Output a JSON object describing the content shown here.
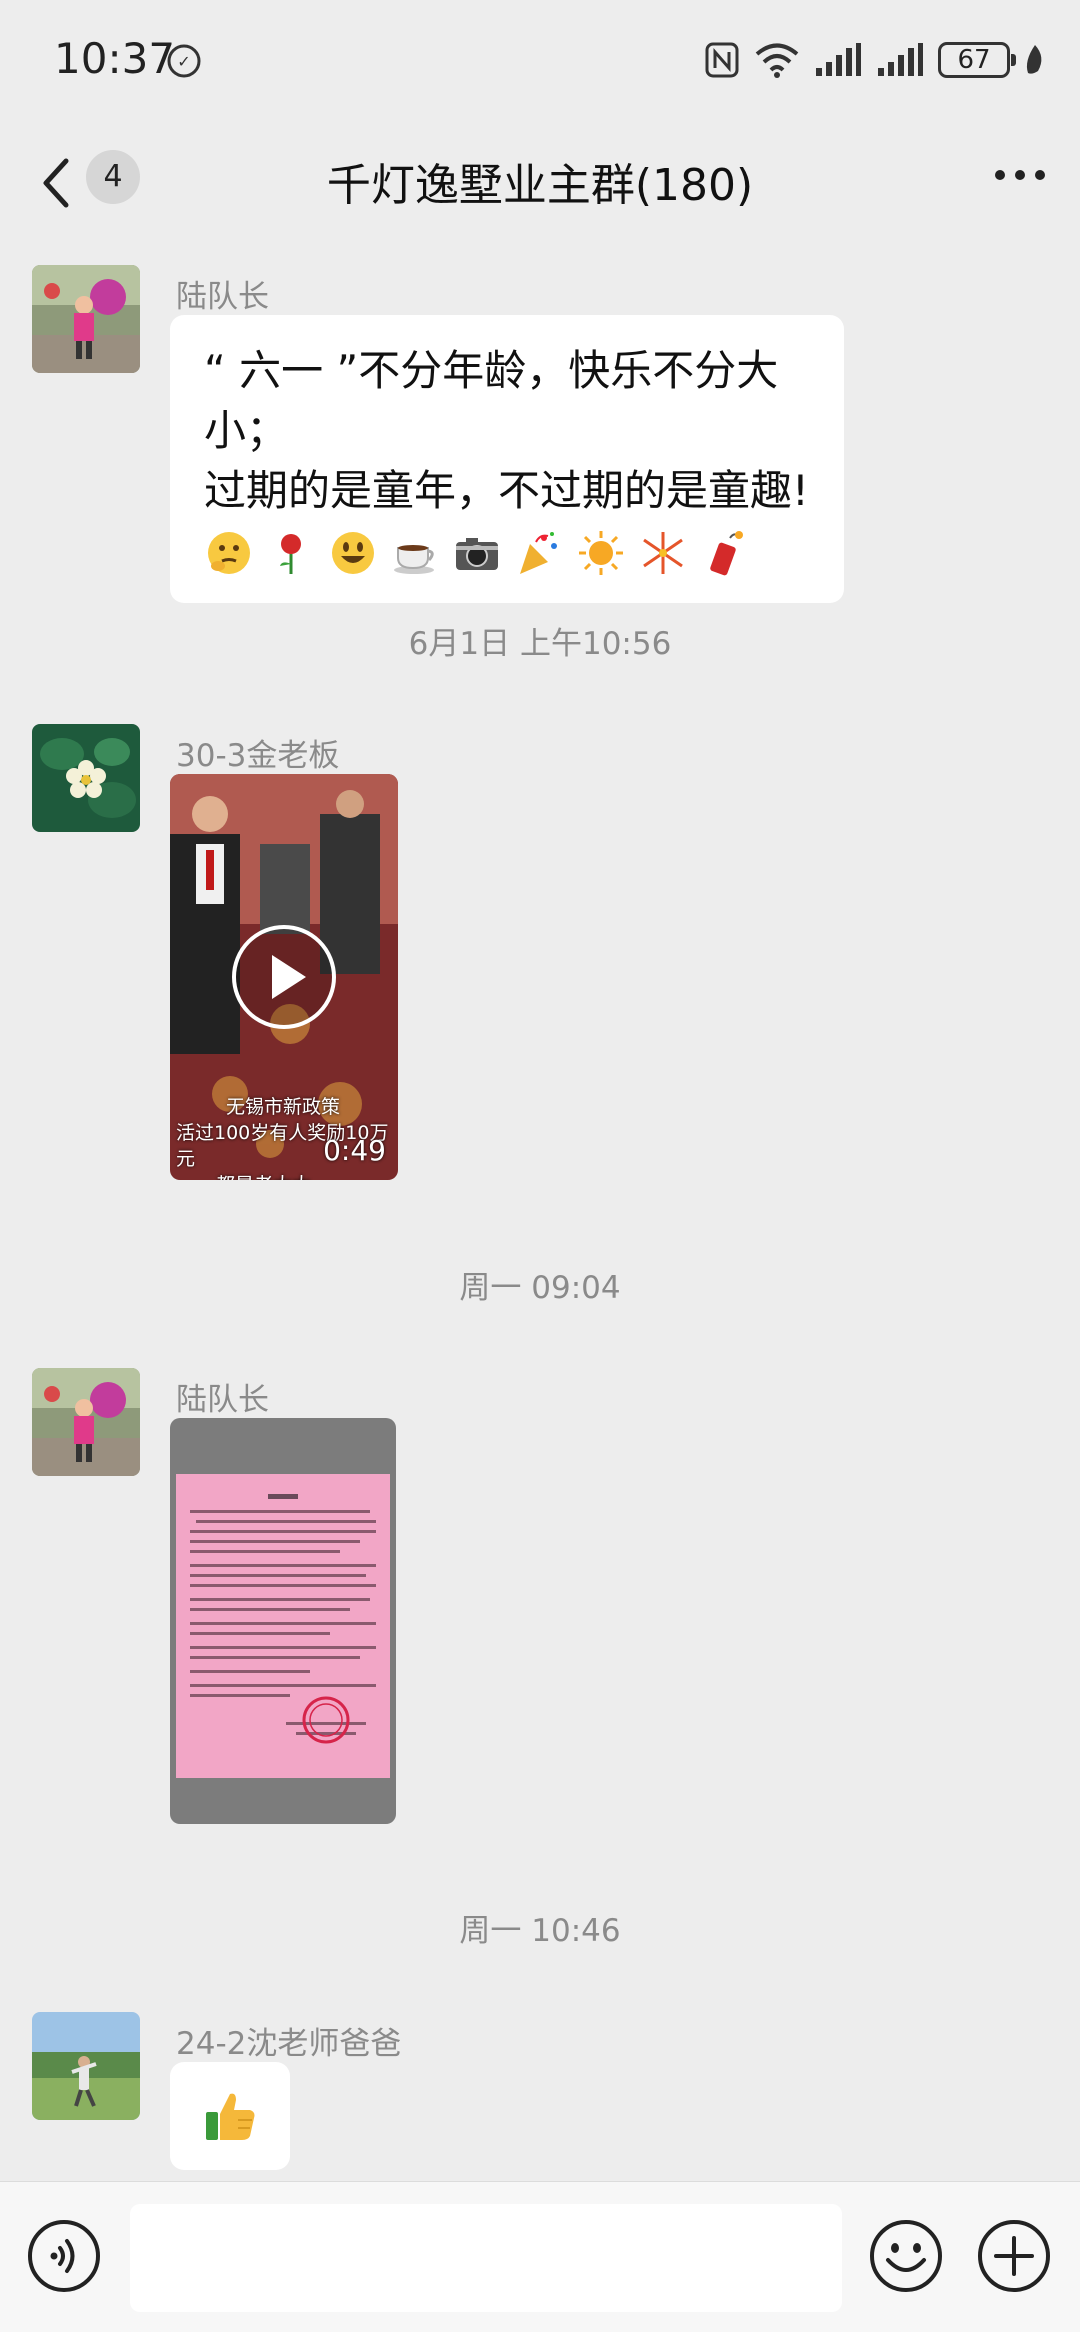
{
  "status_bar": {
    "time": "10:37",
    "battery": "67",
    "icons": [
      "nfc-icon",
      "wifi-icon",
      "signal-icon",
      "signal-icon",
      "battery-icon",
      "leaf-icon"
    ]
  },
  "nav": {
    "back_count": "4",
    "title": "千灯逸墅业主群(180)"
  },
  "messages": [
    {
      "type": "text",
      "sender": "陆队长",
      "line1": "“ 六一 ”不分年龄，快乐不分大小；",
      "line2": "过期的是童年，不过期的是童趣!",
      "emojis": [
        "thinking-face",
        "rose",
        "smiley",
        "coffee",
        "camera",
        "party-popper",
        "sun",
        "fireworks",
        "firecracker"
      ]
    },
    {
      "type": "timestamp",
      "text": "6月1日 上午10:56"
    },
    {
      "type": "video",
      "sender": "30-3金老板",
      "caption_line1": "无锡市新政策",
      "caption_line2": "活过100岁有人奖励10万元",
      "caption_line3": "都是老太太",
      "duration": "0:49"
    },
    {
      "type": "timestamp",
      "text": "周一 09:04"
    },
    {
      "type": "image",
      "sender": "陆队长"
    },
    {
      "type": "timestamp",
      "text": "周一 10:46"
    },
    {
      "type": "sticker",
      "sender": "24-2沈老师爸爸",
      "emoji": "thumbs-up"
    }
  ],
  "input": {
    "placeholder": ""
  },
  "colors": {
    "background": "#ededed",
    "bubble": "#ffffff",
    "meta_text": "#8a8a8a",
    "document_pink": "#f2a6c6"
  }
}
